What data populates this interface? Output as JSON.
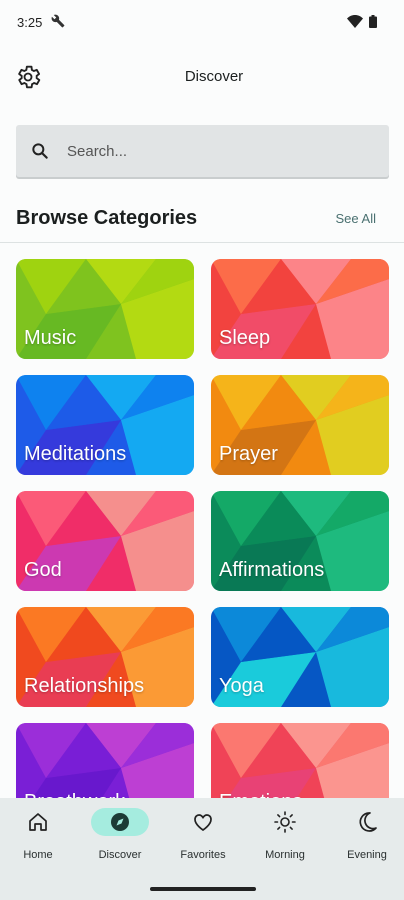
{
  "status": {
    "time": "3:25"
  },
  "topbar": {
    "title": "Discover"
  },
  "search": {
    "placeholder": "Search..."
  },
  "browse": {
    "title": "Browse Categories",
    "see_all": "See All"
  },
  "categories": [
    {
      "label": "Music",
      "colors": [
        "#7fc31f",
        "#a9d80c",
        "#c4e10f",
        "#5fb526"
      ]
    },
    {
      "label": "Sleep",
      "colors": [
        "#f2433f",
        "#ff7a4d",
        "#ff9aa2",
        "#f04f77"
      ]
    },
    {
      "label": "Meditations",
      "colors": [
        "#1e5be8",
        "#0a8ff1",
        "#12c3f6",
        "#3d2fd8"
      ]
    },
    {
      "label": "Prayer",
      "colors": [
        "#f28a10",
        "#f5c21d",
        "#dbe326",
        "#c86d16"
      ]
    },
    {
      "label": "God",
      "colors": [
        "#f02d68",
        "#ff6a7d",
        "#f7b09a",
        "#c03ec9"
      ]
    },
    {
      "label": "Affirmations",
      "colors": [
        "#0b8b5a",
        "#18b36c",
        "#26c98b",
        "#0a7354"
      ]
    },
    {
      "label": "Relationships",
      "colors": [
        "#f04a1f",
        "#ff8a26",
        "#ffb63d",
        "#e73a66"
      ]
    },
    {
      "label": "Yoga",
      "colors": [
        "#0657c4",
        "#0f9ae0",
        "#1fd9e6",
        "#22f1e3"
      ]
    },
    {
      "label": "Breathwork",
      "colors": [
        "#7a1fd6",
        "#a734d9",
        "#d44bd1",
        "#6317c9"
      ]
    },
    {
      "label": "Emotions",
      "colors": [
        "#f04357",
        "#ff8a78",
        "#ffb0a2",
        "#e6417f"
      ]
    }
  ],
  "nav": [
    {
      "label": "Home",
      "icon": "home-icon"
    },
    {
      "label": "Discover",
      "icon": "compass-icon",
      "active": true
    },
    {
      "label": "Favorites",
      "icon": "heart-icon"
    },
    {
      "label": "Morning",
      "icon": "sun-icon"
    },
    {
      "label": "Evening",
      "icon": "moon-icon"
    }
  ],
  "colors": {
    "accent_pill": "#a5ecdf",
    "nav_bg": "#e6ebeb",
    "search_bg": "#e1e4e5"
  }
}
